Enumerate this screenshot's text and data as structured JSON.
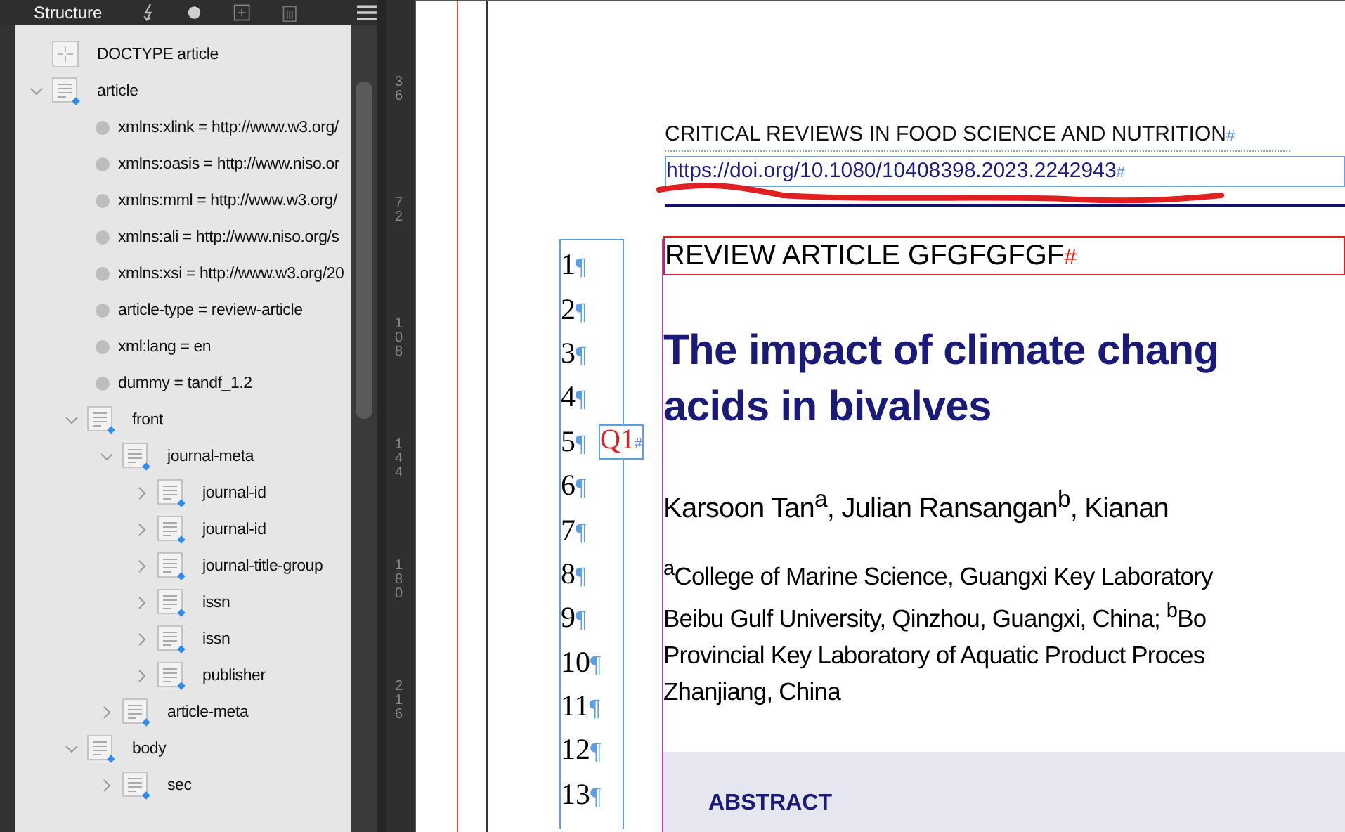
{
  "panel": {
    "title": "Structure"
  },
  "tree": [
    {
      "kind": "doctype",
      "label": "DOCTYPE article"
    },
    {
      "kind": "element",
      "label": "article",
      "expanded": true,
      "children": [
        {
          "kind": "attribute",
          "label": "xmlns:xlink = http://www.w3.org/"
        },
        {
          "kind": "attribute",
          "label": "xmlns:oasis = http://www.niso.or"
        },
        {
          "kind": "attribute",
          "label": "xmlns:mml = http://www.w3.org/"
        },
        {
          "kind": "attribute",
          "label": "xmlns:ali = http://www.niso.org/s"
        },
        {
          "kind": "attribute",
          "label": "xmlns:xsi = http://www.w3.org/20"
        },
        {
          "kind": "attribute",
          "label": "article-type = review-article"
        },
        {
          "kind": "attribute",
          "label": "xml:lang = en"
        },
        {
          "kind": "attribute",
          "label": "dummy = tandf_1.2"
        },
        {
          "kind": "element",
          "label": "front",
          "expanded": true,
          "children": [
            {
              "kind": "element",
              "label": "journal-meta",
              "expanded": true,
              "children": [
                {
                  "kind": "element",
                  "label": "journal-id",
                  "expanded": false
                },
                {
                  "kind": "element",
                  "label": "journal-id",
                  "expanded": false
                },
                {
                  "kind": "element",
                  "label": "journal-title-group",
                  "expanded": false
                },
                {
                  "kind": "element",
                  "label": "issn",
                  "expanded": false
                },
                {
                  "kind": "element",
                  "label": "issn",
                  "expanded": false
                },
                {
                  "kind": "element",
                  "label": "publisher",
                  "expanded": false
                }
              ]
            },
            {
              "kind": "element",
              "label": "article-meta",
              "expanded": false
            }
          ]
        },
        {
          "kind": "element",
          "label": "body",
          "expanded": true,
          "children": [
            {
              "kind": "element",
              "label": "sec",
              "expanded": false
            }
          ]
        }
      ]
    }
  ],
  "ruler_marks": [
    "36",
    "72",
    "108",
    "144",
    "180",
    "216"
  ],
  "document": {
    "journal": "CRITICAL REVIEWS IN FOOD SCIENCE AND NUTRITION",
    "journal_mark": "#",
    "doi": "https://doi.org/10.1080/10408398.2023.2242943",
    "doi_mark": "#",
    "article_type": "REVIEW ARTICLE GFGFGFGF",
    "article_type_mark": "#",
    "title_lines": [
      "The impact of climate chang",
      "acids in bivalves"
    ],
    "authors": "Karsoon Tan$^{a}$, Julian Ransangan$^{b}$, Kianan",
    "affiliation_lines": [
      "$^{a}$College of Marine Science, Guangxi Key Laboratory",
      "Beibu Gulf University, Qinzhou, Guangxi, China; $^{b}$Bo",
      "Provincial Key Laboratory of Aquatic Product Proces",
      "Zhanjiang, China"
    ],
    "abstract_heading": "ABSTRACT",
    "line_numbers": [
      {
        "number": "1"
      },
      {
        "number": "2"
      },
      {
        "number": "3"
      },
      {
        "number": "4"
      },
      {
        "number": "5",
        "query": {
          "label": "Q1",
          "mark": "#"
        }
      },
      {
        "number": "6"
      },
      {
        "number": "7"
      },
      {
        "number": "8"
      },
      {
        "number": "9"
      },
      {
        "number": "10"
      },
      {
        "number": "11"
      },
      {
        "number": "12"
      },
      {
        "number": "13"
      }
    ],
    "pilcrow": "¶"
  }
}
